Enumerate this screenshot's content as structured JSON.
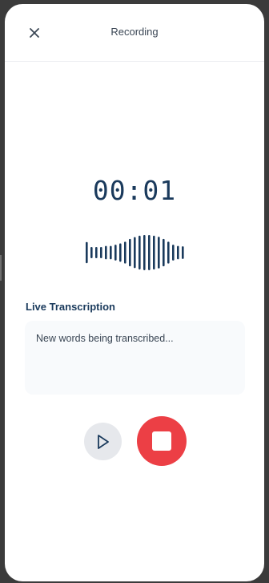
{
  "header": {
    "title": "Recording",
    "close_icon": "close-icon"
  },
  "recorder": {
    "timer": "00:01",
    "waveform_levels": [
      0.6,
      0.32,
      0.32,
      0.32,
      0.38,
      0.38,
      0.45,
      0.52,
      0.62,
      0.78,
      0.88,
      0.96,
      1.0,
      1.0,
      0.96,
      0.9,
      0.78,
      0.62,
      0.45,
      0.38,
      0.36
    ]
  },
  "transcription": {
    "label": "Live Transcription",
    "text": "New words being transcribed..."
  },
  "controls": {
    "play_icon": "play-icon",
    "stop_icon": "stop-icon"
  },
  "colors": {
    "accent": "#1a3a5c",
    "stop": "#ec3f45",
    "play_bg": "#e6e8ec"
  }
}
